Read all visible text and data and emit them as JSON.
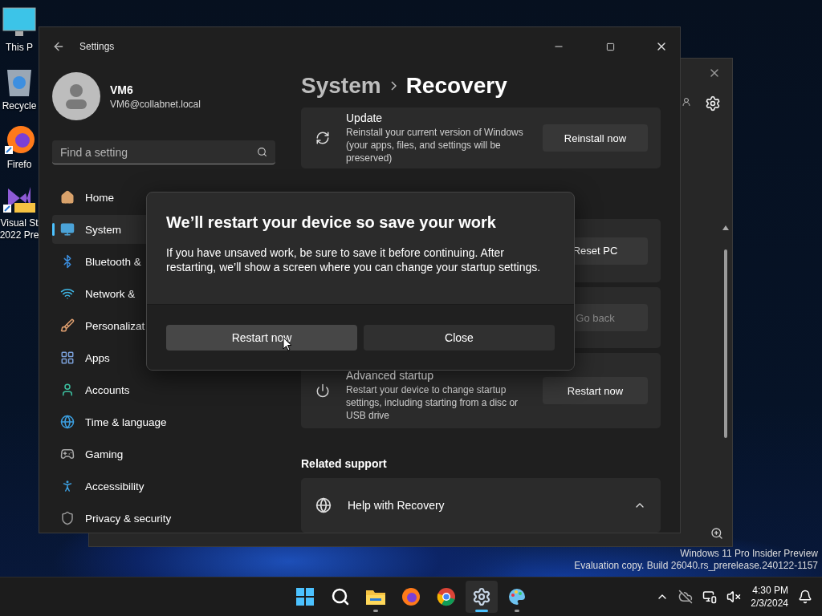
{
  "desktop_icons": [
    {
      "label": "This P"
    },
    {
      "label": "Recycle"
    },
    {
      "label": "Firefo"
    },
    {
      "label": "Visual St\n2022 Pre"
    }
  ],
  "settings_window": {
    "title": "Settings",
    "user": {
      "name": "VM6",
      "email": "VM6@collabnet.local"
    },
    "search": {
      "placeholder": "Find a setting"
    },
    "nav_items": [
      {
        "label": "Home",
        "selected": false
      },
      {
        "label": "System",
        "selected": true
      },
      {
        "label": "Bluetooth &",
        "selected": false
      },
      {
        "label": "Network &",
        "selected": false
      },
      {
        "label": "Personalizat",
        "selected": false
      },
      {
        "label": "Apps",
        "selected": false
      },
      {
        "label": "Accounts",
        "selected": false
      },
      {
        "label": "Time & language",
        "selected": false
      },
      {
        "label": "Gaming",
        "selected": false
      },
      {
        "label": "Accessibility",
        "selected": false
      },
      {
        "label": "Privacy & security",
        "selected": false
      }
    ],
    "breadcrumb": [
      "System",
      "Recovery"
    ],
    "cards": [
      {
        "kind": "update",
        "title": "Update",
        "description": "Reinstall your current version of Windows (your apps, files, and settings will be preserved)",
        "button": "Reinstall now",
        "disabled": false
      },
      {
        "kind": "hidden",
        "button": "Reset PC",
        "disabled": false
      },
      {
        "kind": "hidden",
        "button": "Go back",
        "disabled": true
      },
      {
        "kind": "startup",
        "title": "Advanced startup",
        "description": "Restart your device to change startup settings, including starting from a disc or USB drive",
        "button": "Restart now",
        "disabled": false
      }
    ],
    "related_heading": "Related support",
    "help_card": {
      "title": "Help with Recovery",
      "expanded": true
    }
  },
  "dialog": {
    "title": "We’ll restart your device so save your work",
    "body": "If you have unsaved work, be sure to save it before continuing. After restarting, we’ll show a screen where you can change your startup settings.",
    "buttons": [
      {
        "label": "Restart now",
        "hovered": true
      },
      {
        "label": "Close",
        "hovered": false
      }
    ]
  },
  "watermark": [
    "Windows 11 Pro Insider Preview",
    "Evaluation copy. Build 26040.rs_prerelease.240122-1157"
  ],
  "taskbar": {
    "apps": [
      {
        "kind": "start",
        "selected": false,
        "running": false
      },
      {
        "kind": "search",
        "selected": false,
        "running": false
      },
      {
        "kind": "explorer",
        "selected": false,
        "running": true
      },
      {
        "kind": "firefox",
        "selected": false,
        "running": false
      },
      {
        "kind": "chrome",
        "selected": false,
        "running": false
      },
      {
        "kind": "settings",
        "selected": true,
        "running": true
      },
      {
        "kind": "paint",
        "selected": false,
        "running": true
      }
    ],
    "time": "4:30 PM",
    "date": "2/3/2024"
  }
}
